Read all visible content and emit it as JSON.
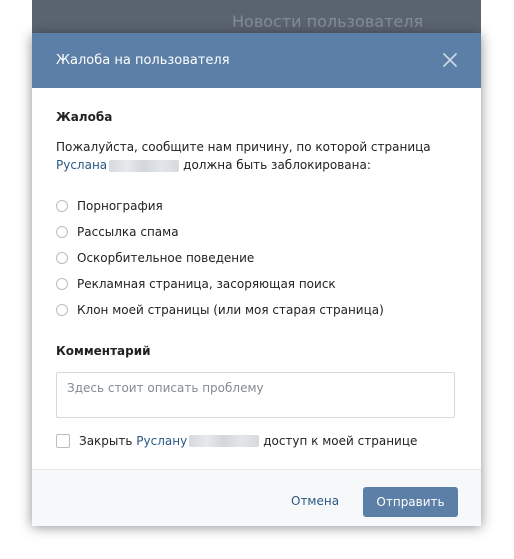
{
  "backdrop": {
    "title": "Новости пользователя"
  },
  "modal": {
    "title": "Жалоба на пользователя",
    "close_icon": "close-icon",
    "section_complaint": "Жалоба",
    "description": {
      "line1": "Пожалуйста, сообщите нам причину, по которой страница",
      "user_link": "Руслана",
      "line2_suffix": "должна быть заблокирована:"
    },
    "reasons": [
      {
        "label": "Порнография"
      },
      {
        "label": "Рассылка спама"
      },
      {
        "label": "Оскорбительное поведение"
      },
      {
        "label": "Рекламная страница, засоряющая поиск"
      },
      {
        "label": "Клон моей страницы (или моя старая страница)"
      }
    ],
    "section_comment": "Комментарий",
    "comment": {
      "value": "",
      "placeholder": "Здесь стоит описать проблему"
    },
    "block_access": {
      "prefix": "Закрыть",
      "user_link": "Руслану",
      "suffix": "доступ к моей странице",
      "checked": false
    },
    "footer": {
      "cancel_label": "Отмена",
      "submit_label": "Отправить"
    }
  },
  "colors": {
    "header": "#5b7fa6",
    "link": "#2a5885",
    "button": "#5b7fa6"
  }
}
